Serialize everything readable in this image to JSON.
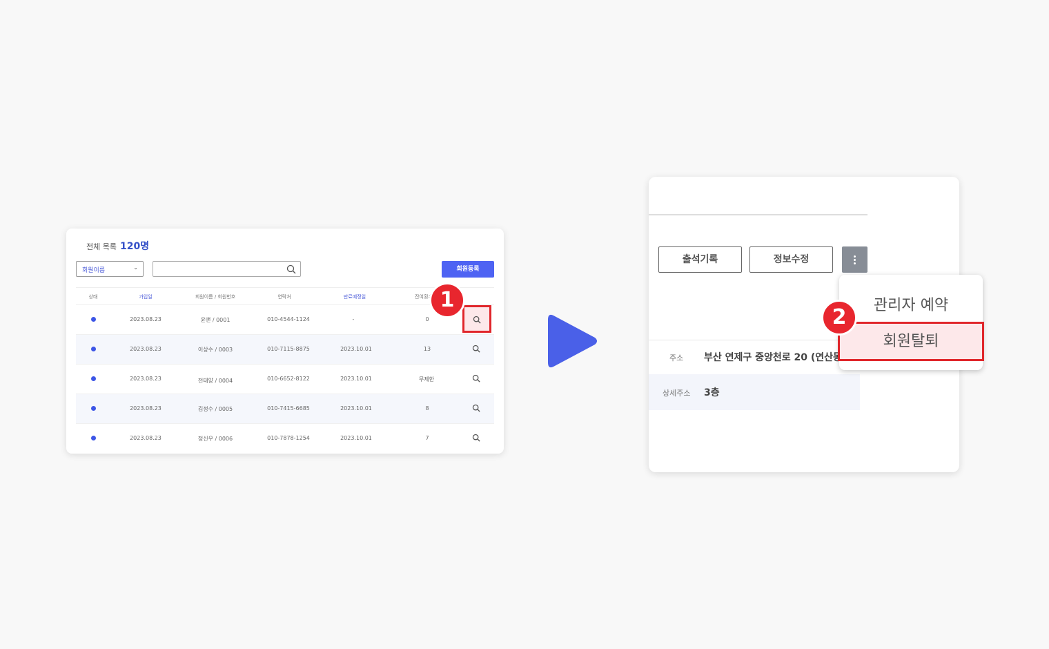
{
  "member_list": {
    "total_label": "전체 목록",
    "total_count": "120명",
    "filter_select": "회원이름",
    "register_button": "회원등록",
    "columns": [
      "상태",
      "가입일",
      "회원이름 / 회원번호",
      "연락처",
      "만료예정일",
      "잔여횟수"
    ],
    "rows": [
      {
        "joined": "2023.08.23",
        "member": "윤맨 / 0001",
        "phone": "010-4544-1124",
        "expiry": "-",
        "remaining": "0"
      },
      {
        "joined": "2023.08.23",
        "member": "이상수 / 0003",
        "phone": "010-7115-8875",
        "expiry": "2023.10.01",
        "remaining": "13"
      },
      {
        "joined": "2023.08.23",
        "member": "전태양 / 0004",
        "phone": "010-6652-8122",
        "expiry": "2023.10.01",
        "remaining": "무제한"
      },
      {
        "joined": "2023.08.23",
        "member": "김정수 / 0005",
        "phone": "010-7415-6685",
        "expiry": "2023.10.01",
        "remaining": "8"
      },
      {
        "joined": "2023.08.23",
        "member": "정신우 / 0006",
        "phone": "010-7878-1254",
        "expiry": "2023.10.01",
        "remaining": "7"
      }
    ],
    "step_badge": "1"
  },
  "member_detail": {
    "attendance_button": "출석기록",
    "edit_button": "정보수정",
    "address_label": "주소",
    "address_value": "부산 연제구 중앙천로 20 (연산동)",
    "detail_address_label": "상세주소",
    "detail_address_value": "3층",
    "menu_items": [
      "관리자 예약",
      "회원탈퇴"
    ],
    "step_badge": "2"
  },
  "colors": {
    "accent": "#4e63f3",
    "highlight": "#e0262b",
    "play": "#4a60e8"
  }
}
